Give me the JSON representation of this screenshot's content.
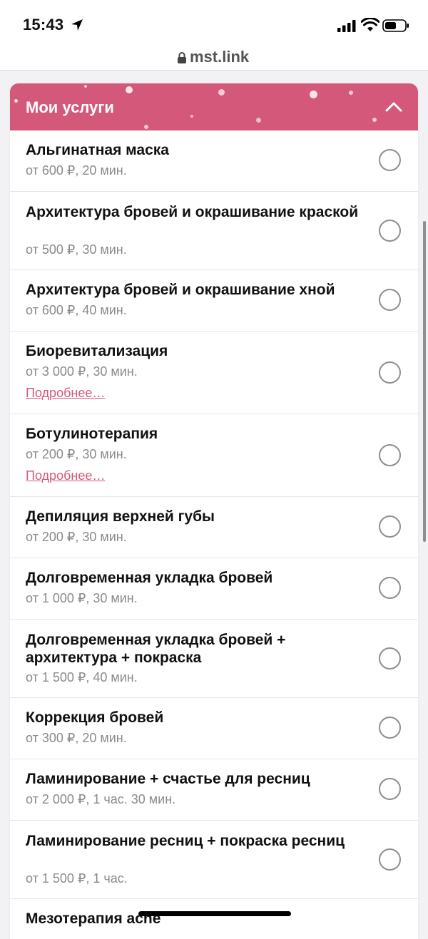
{
  "status": {
    "time": "15:43"
  },
  "browser": {
    "url": "mst.link"
  },
  "panel": {
    "title": "Мои услуги"
  },
  "services": [
    {
      "name": "Альгинатная маска",
      "meta": "от 600 ₽, 20 мин."
    },
    {
      "name": "Архитектура бровей и окрашивание краской",
      "meta": "от 500 ₽, 30 мин."
    },
    {
      "name": "Архитектура бровей и окрашивание хной",
      "meta": "от 600 ₽, 40 мин."
    },
    {
      "name": "Биоревитализация",
      "meta": "от 3 000 ₽, 30 мин.",
      "link": "Подробнее…"
    },
    {
      "name": "Ботулинотерапия",
      "meta": "от 200 ₽, 30 мин.",
      "link": "Подробнее…"
    },
    {
      "name": "Депиляция верхней губы",
      "meta": "от 200 ₽, 30 мин."
    },
    {
      "name": "Долговременная укладка бровей",
      "meta": "от 1 000 ₽, 30 мин."
    },
    {
      "name": "Долговременная укладка бровей + архитектура + покраска",
      "meta": "от 1 500 ₽, 40 мин."
    },
    {
      "name": "Коррекция бровей",
      "meta": "от 300 ₽, 20 мин."
    },
    {
      "name": "Ламинирование + счастье для ресниц",
      "meta": "от 2 000 ₽, 1 час. 30 мин."
    },
    {
      "name": "Ламинирование ресниц + покраска ресниц",
      "meta": "от 1 500 ₽, 1 час."
    },
    {
      "name": "Мезотерапия acne",
      "meta": ""
    }
  ],
  "colors": {
    "accent": "#d4587a",
    "muted": "#8a8a8f"
  }
}
